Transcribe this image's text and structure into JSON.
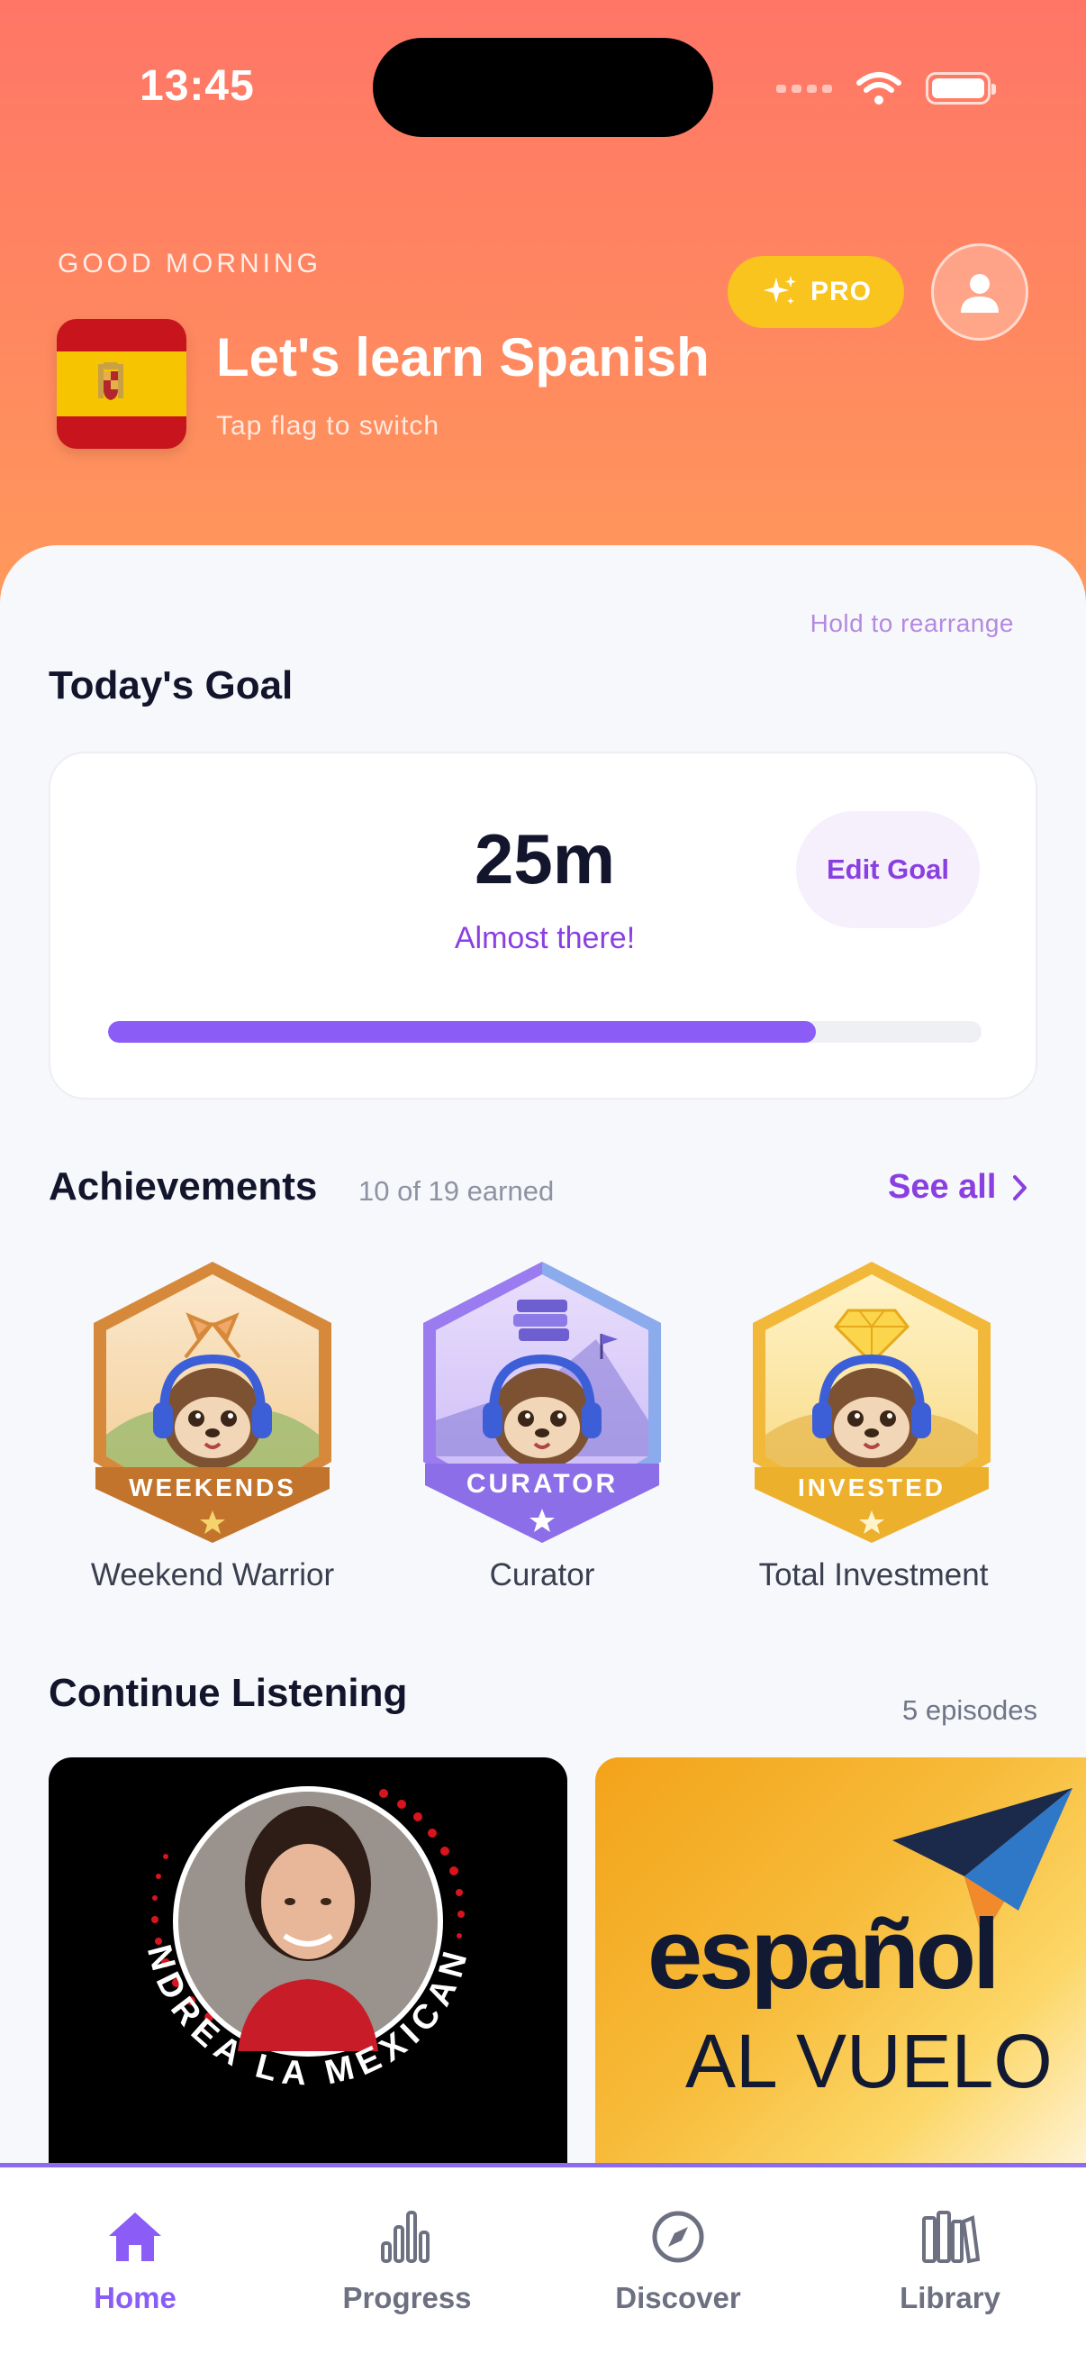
{
  "status_bar": {
    "time": "13:45"
  },
  "header": {
    "greeting": "GOOD MORNING",
    "title": "Let's learn Spanish",
    "subtitle": "Tap flag to switch",
    "pro_label": "PRO",
    "flag_icon": "spain-flag-icon",
    "pro_color": "#f9c41e",
    "gradient_top": "#ff7667",
    "gradient_bottom": "#ff9a5c"
  },
  "main": {
    "hold_hint": "Hold to rearrange",
    "goal": {
      "heading": "Today's Goal",
      "value": "25m",
      "message": "Almost there!",
      "edit_label": "Edit Goal",
      "progress_fraction": 0.81,
      "accent": "#8b5cf6"
    },
    "achievements": {
      "heading": "Achievements",
      "count": "10 of 19 earned",
      "see_all": "See all",
      "badges": [
        {
          "banner": "WEEKENDS",
          "label": "Weekend Warrior",
          "theme": "#d7893b"
        },
        {
          "banner": "CURATOR",
          "label": "Curator",
          "theme": "#9a7cf0"
        },
        {
          "banner": "INVESTED",
          "label": "Total Investment",
          "theme": "#f2b83a"
        }
      ]
    },
    "continue": {
      "heading": "Continue Listening",
      "count": "5 episodes",
      "podcasts": [
        {
          "ring_text": "ANDREA LA MEXICANA"
        },
        {
          "title_line1": "español",
          "title_line2": "AL VUELO"
        }
      ]
    }
  },
  "tabbar": {
    "tabs": [
      {
        "label": "Home",
        "icon": "home-icon",
        "active": true
      },
      {
        "label": "Progress",
        "icon": "bar-chart-icon",
        "active": false
      },
      {
        "label": "Discover",
        "icon": "compass-icon",
        "active": false
      },
      {
        "label": "Library",
        "icon": "library-icon",
        "active": false
      }
    ]
  }
}
